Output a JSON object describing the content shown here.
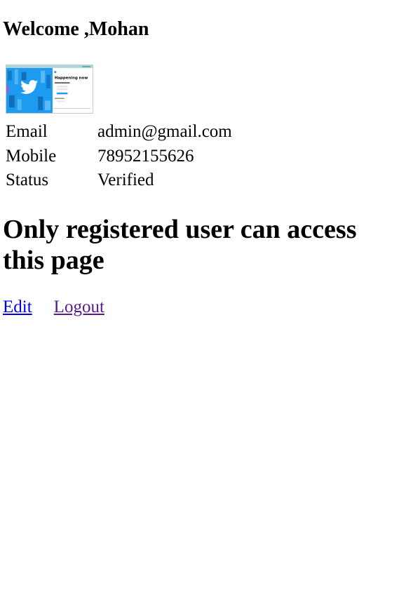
{
  "header": {
    "welcome_text": "Welcome ,Mohan"
  },
  "profile": {
    "image_alt": "profile picture",
    "image_heading": "Happening now",
    "fields": [
      {
        "label": "Email",
        "value": "admin@gmail.com"
      },
      {
        "label": "Mobile",
        "value": "78952155626"
      },
      {
        "label": "Status",
        "value": "Verified"
      }
    ]
  },
  "notice": {
    "text": "Only registered user can access this page"
  },
  "actions": {
    "edit_label": "Edit",
    "logout_label": "Logout",
    "edit_color": "#0000ee",
    "logout_color": "#551a8b"
  }
}
